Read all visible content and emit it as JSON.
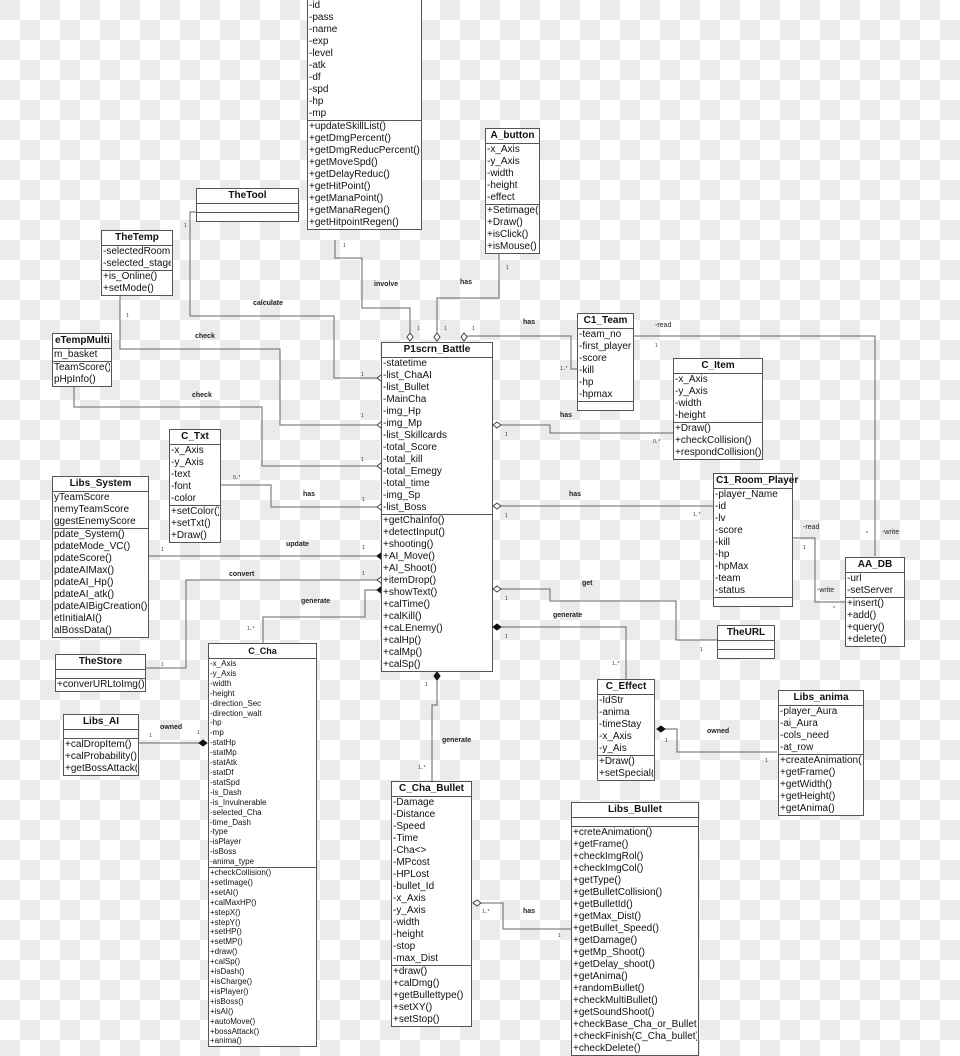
{
  "classes": {
    "player": {
      "title": "",
      "attributes": [
        "-id",
        "-pass",
        "-name",
        "-exp",
        "-level",
        "-atk",
        "-df",
        "-spd",
        "-hp",
        "-mp"
      ],
      "methods": [
        "+updateSkillList()",
        "+getDmgPercent()",
        "+getDmgReducPercent()",
        "+getMoveSpd()",
        "+getDelayReduc()",
        "+getHitPoint()",
        "+getManaPoint()",
        "+getManaRegen()",
        "+getHitpointRegen()"
      ]
    },
    "a_button": {
      "title": "A_button",
      "attributes": [
        "-x_Axis",
        "-y_Axis",
        "-width",
        "-height",
        "-effect"
      ],
      "methods": [
        "+Setimage()",
        "+Draw()",
        "+isClick()",
        "+isMouse()"
      ]
    },
    "the_tool": {
      "title": "TheTool",
      "attributes": [],
      "methods": []
    },
    "the_temp": {
      "title": "TheTemp",
      "attributes": [
        "-selectedRoom",
        "-selected_stage"
      ],
      "methods": [
        "+is_Online()",
        "+setMode()"
      ]
    },
    "the_temp_multi": {
      "title": "eTempMulti",
      "attributes": [
        "m_basket"
      ],
      "methods": [
        "TeamScore()",
        "pHpInfo()"
      ]
    },
    "c1_team": {
      "title": "C1_Team",
      "attributes": [
        "-team_no",
        "-first_player",
        "-score",
        "-kill",
        "-hp",
        "-hpmax"
      ],
      "methods": []
    },
    "c_item": {
      "title": "C_Item",
      "attributes": [
        "-x_Axis",
        "-y_Axis",
        "-width",
        "-height"
      ],
      "methods": [
        "+Draw()",
        "+checkCollision()",
        "+respondCollision()"
      ]
    },
    "p1scrn_battle": {
      "title": "P1scrn_Battle",
      "attributes": [
        "-statetime",
        "-list_ChaAI",
        "-list_Bullet",
        "-MainCha",
        "-img_Hp",
        "-img_Mp",
        "-list_Skillcards",
        "-total_Score",
        "-total_kill",
        "-total_Emegy",
        "-total_time",
        "-img_Sp",
        "-list_Boss"
      ],
      "methods": [
        "+getChaInfo()",
        "+detectInput()",
        "+shooting()",
        "+AI_Move()",
        "+AI_Shoot()",
        "+itemDrop()",
        "+showText()",
        "+calTime()",
        "+calKill()",
        "+caLEnemy()",
        "+calHp()",
        "+calMp()",
        "+calSp()"
      ]
    },
    "c_txt": {
      "title": "C_Txt",
      "attributes": [
        "-x_Axis",
        "-y_Axis",
        "-text",
        "-font",
        "-color"
      ],
      "methods": [
        "+setColor()",
        "+setTxt()",
        "+Draw()"
      ]
    },
    "libs_system": {
      "title": "Libs_System",
      "attributes": [
        "yTeamScore",
        "nemyTeamScore",
        "ggestEnemyScore"
      ],
      "methods": [
        "pdate_System()",
        "pdateMode_VC()",
        "pdateScore()",
        "pdateAIMax()",
        "pdateAI_Hp()",
        "pdateAI_atk()",
        "pdateAIBigCreation()",
        "etInitialAI()",
        "alBossData()"
      ]
    },
    "c1_room_player": {
      "title": "C1_Room_Player",
      "attributes": [
        "-player_Name",
        "-id",
        "-lv",
        "-score",
        "-kill",
        "-hp",
        "-hpMax",
        "-team",
        "-status"
      ],
      "methods": []
    },
    "aa_db": {
      "title": "AA_DB",
      "attributes": [
        "-url",
        "-setServer"
      ],
      "methods": [
        "+insert()",
        "+add()",
        "+query()",
        "+delete()"
      ]
    },
    "the_url": {
      "title": "TheURL",
      "attributes": [],
      "methods": []
    },
    "the_store": {
      "title": "TheStore",
      "attributes": [],
      "methods": [
        "+converURLtoImg()"
      ]
    },
    "c_cha": {
      "title": "C_Cha",
      "attributes": [
        "-x_Axis",
        "-y_Axis",
        "-width",
        "-height",
        "-direction_Sec",
        "-direction_walt",
        "-hp",
        "-mp",
        "-statHp",
        "-statMp",
        "-statAtk",
        "-statDf",
        "-statSpd",
        "-is_Dash",
        "-is_Invulnerable",
        "-selected_Cha",
        "-time_Dash",
        "-type",
        "-isPlayer",
        "-isBoss",
        "-anima_type"
      ],
      "methods": [
        "+checkCollision()",
        "+setImage()",
        "+setAI()",
        "+calMaxHP()",
        "+stepX()",
        "+stepY()",
        "+setHP()",
        "+setMP()",
        "+draw()",
        "+calSp()",
        "+isDash()",
        "+isCharge()",
        "+isPlayer()",
        "+isBoss()",
        "+isAI()",
        "+autoMove()",
        "+bossAttack()",
        "+anima()"
      ]
    },
    "libs_ai": {
      "title": "Libs_AI",
      "attributes": [],
      "methods": [
        "+calDropItem()",
        "+calProbability()",
        "+getBossAttack()"
      ]
    },
    "c_effect": {
      "title": "C_Effect",
      "attributes": [
        "-IdStr",
        "-anima",
        "-timeStay",
        "-x_Axis",
        "-y_Ais"
      ],
      "methods": [
        "+Draw()",
        "+setSpecial()"
      ]
    },
    "libs_anima": {
      "title": "Libs_anima",
      "attributes": [
        "-player_Aura",
        "-ai_Aura",
        "-cols_need",
        "-at_row"
      ],
      "methods": [
        "+createAnimation()",
        "+getFrame()",
        "+getWidth()",
        "+getHeight()",
        "+getAnima()"
      ]
    },
    "c_cha_bullet": {
      "title": "C_Cha_Bullet",
      "attributes": [
        "-Damage",
        "-Distance",
        "-Speed",
        "-Time",
        "-Cha<>",
        "-MPcost",
        "-HPLost",
        "-bullet_Id",
        "-x_Axis",
        "-y_Axis",
        "-width",
        "-height",
        "-stop",
        "-max_Dist"
      ],
      "methods": [
        "+draw()",
        "+calDmg()",
        "+getBullettype()",
        "+setXY()",
        "+setStop()"
      ]
    },
    "libs_bullet": {
      "title": "Libs_Bullet",
      "attributes": [],
      "methods": [
        "+creteAnimation()",
        "+getFrame()",
        "+checkImgRol()",
        "+checkImgCol()",
        "+getType()",
        "+getBulletCollision()",
        "+getBulletId()",
        "+getMax_Dist()",
        "+getBullet_Speed()",
        "+getDamage()",
        "+getMp_Shoot()",
        "+getDelay_shoot()",
        "+getAnima()",
        "+randomBullet()",
        "+checkMultiBullet()",
        "+getSoundShoot()",
        "+checkBase_Cha_or_Bullet()",
        "+checkFinish(C_Cha_bullet)()",
        "+checkDelete()"
      ]
    }
  },
  "relations": {
    "involve": "involve",
    "has_button": "has",
    "calculate": "calculate",
    "check_temp": "check",
    "check_multi": "check",
    "has_team": "has",
    "has_item": "has",
    "has_txt": "has",
    "has_room_player": "has",
    "update": "update",
    "convert": "convert",
    "generate_cha": "generate",
    "get": "get",
    "generate_effect": "generate",
    "generate_bullet": "generate",
    "owned_ai": "owned",
    "owned_anima": "owned",
    "has_libs_bullet": "has",
    "read_team": "-read",
    "read_room": "-read",
    "write_room": "-write",
    "write_db": "-write"
  },
  "multiplicities": {
    "one": "1",
    "one_many": "1..*",
    "zero_many": "0..*",
    "many": "*"
  }
}
